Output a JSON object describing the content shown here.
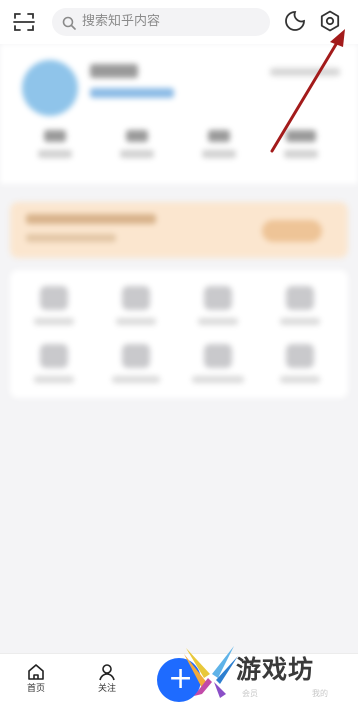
{
  "search": {
    "placeholder": "搜索知乎内容"
  },
  "bottom_nav": {
    "items": [
      {
        "label": "首页",
        "icon": "home-icon"
      },
      {
        "label": "关注",
        "icon": "user-icon"
      },
      {
        "label": "",
        "icon": "plus-icon"
      }
    ],
    "ghost_labels": [
      "会员",
      "我的"
    ]
  },
  "watermark": {
    "text": "游戏坊"
  },
  "colors": {
    "accent": "#1e6bff",
    "annotation_arrow": "#a31b1b"
  }
}
